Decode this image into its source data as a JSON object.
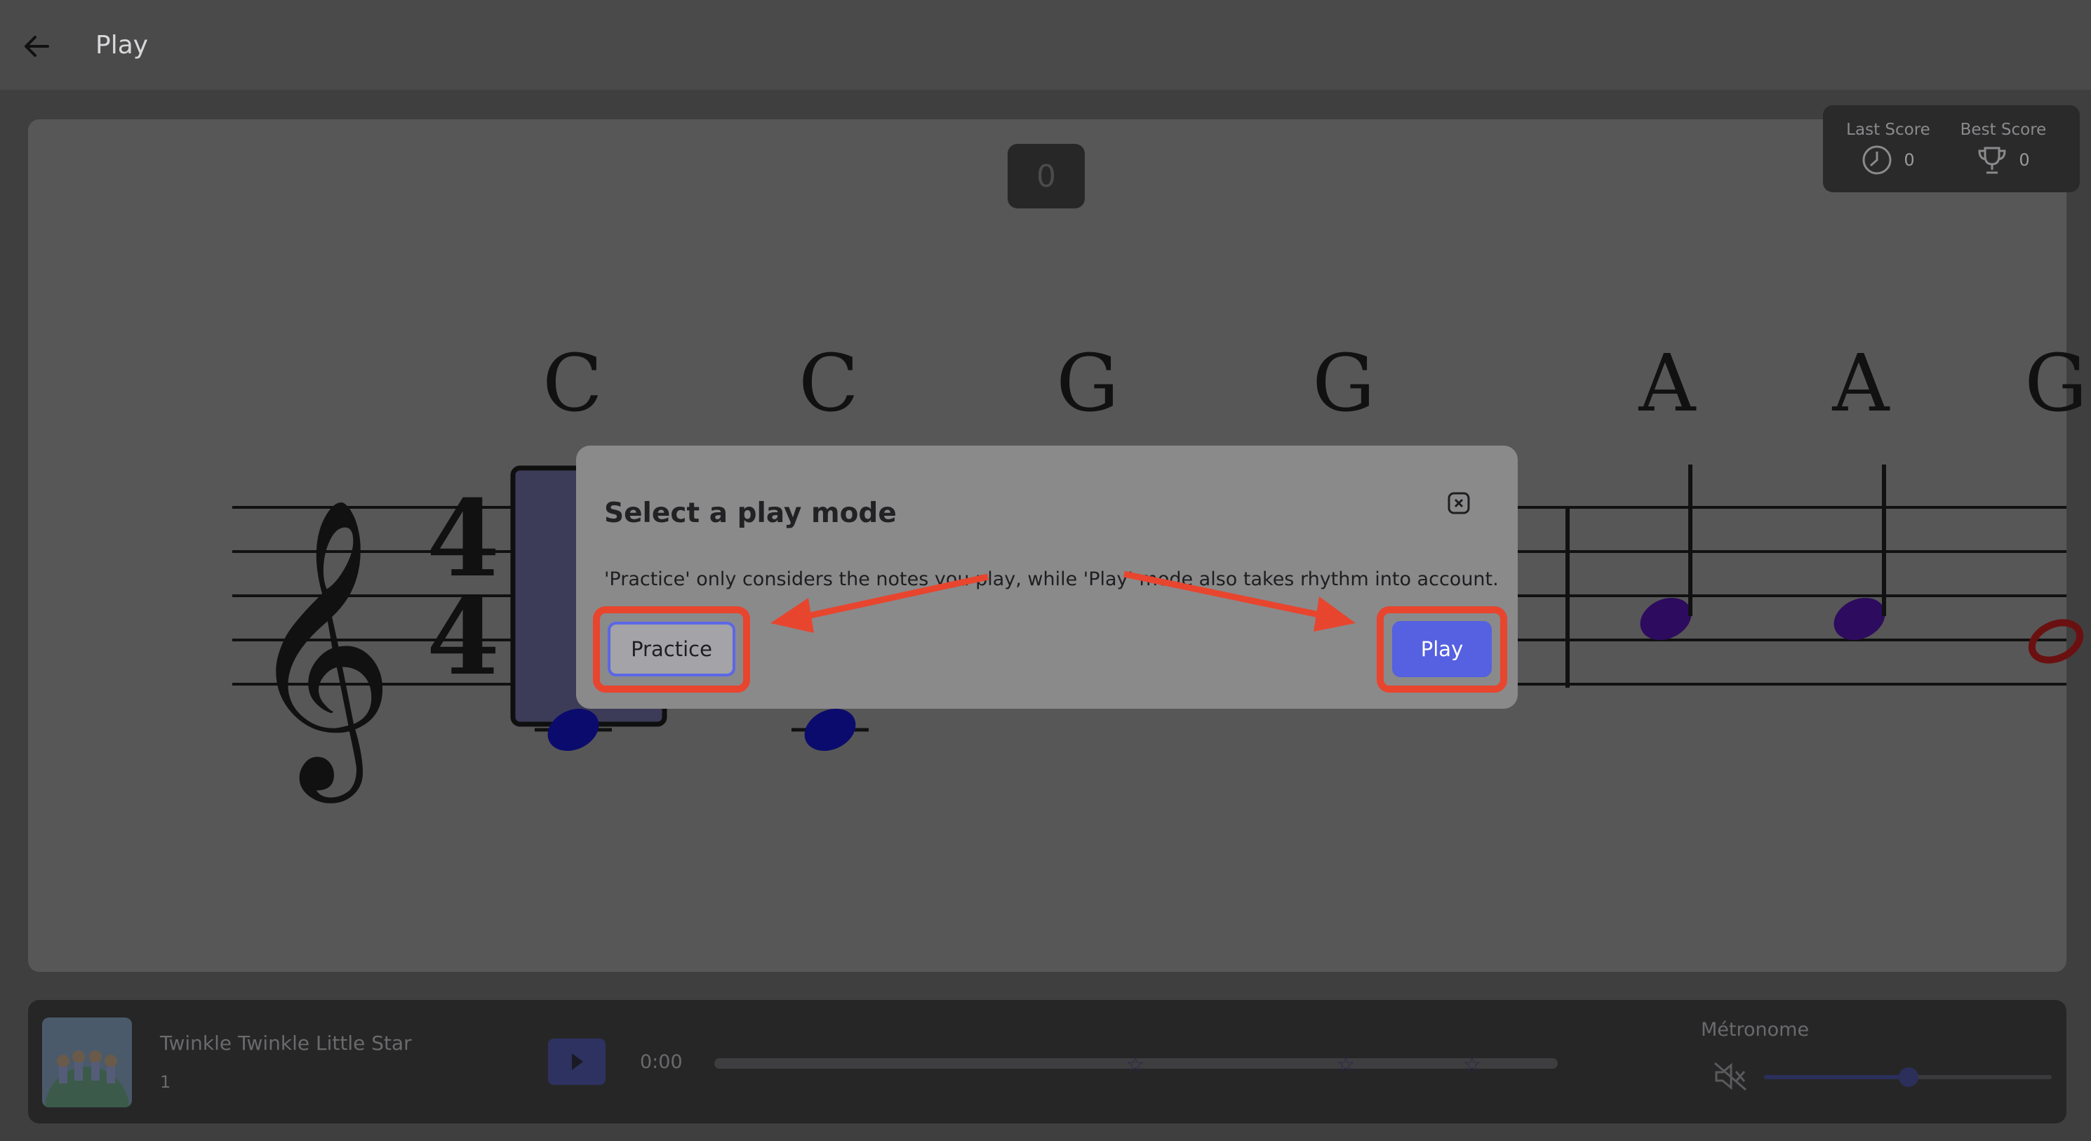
{
  "header": {
    "title": "Play",
    "back_icon": "arrow-left-icon"
  },
  "score": {
    "current": "0",
    "last_label": "Last Score",
    "last_value": "0",
    "best_label": "Best Score",
    "best_value": "0"
  },
  "sheet": {
    "time_signature": [
      "4",
      "4"
    ],
    "note_labels": [
      "C",
      "C",
      "G",
      "G",
      "A",
      "A",
      "G"
    ]
  },
  "modal": {
    "title": "Select a play mode",
    "description": "'Practice' only considers the notes you play, while 'Play' mode also takes rhythm into account.",
    "practice_label": "Practice",
    "play_label": "Play",
    "close_icon": "close-icon"
  },
  "player": {
    "song_title": "Twinkle Twinkle Little Star",
    "song_number": "1",
    "time": "0:00",
    "metronome_label": "Métronome",
    "volume_level": 0.5
  },
  "colors": {
    "accent": "#5561e0",
    "highlight": "#e8452e"
  }
}
